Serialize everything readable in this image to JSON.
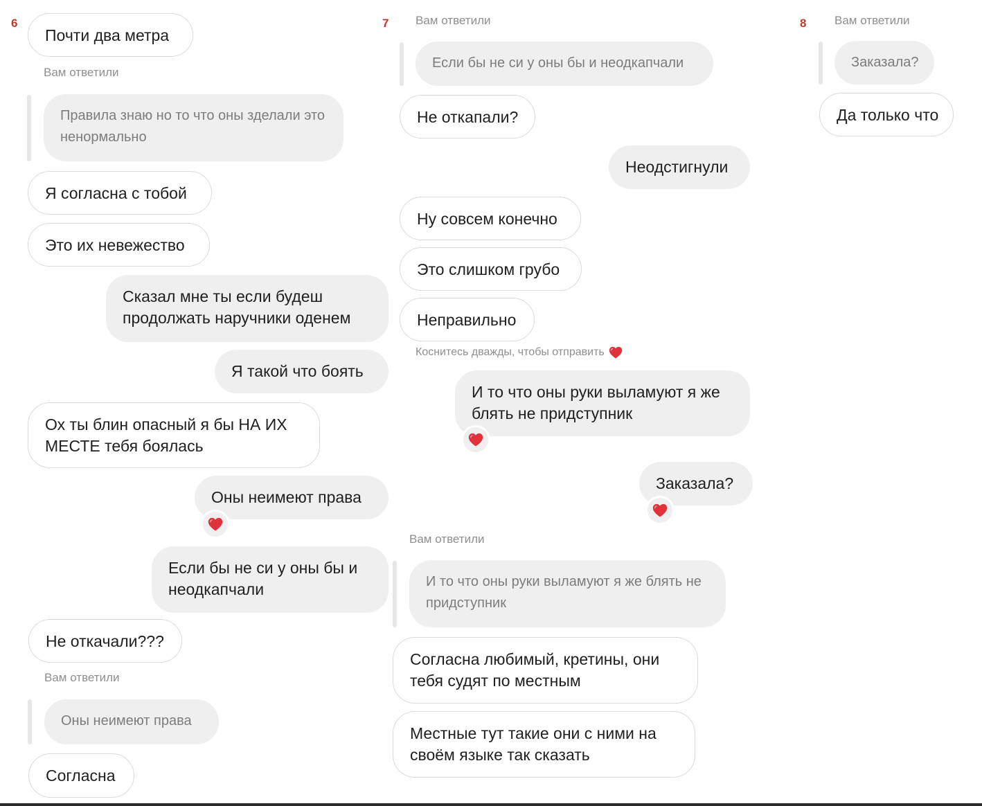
{
  "columns": [
    {
      "number": "6",
      "items": [
        {
          "text": "Почти два метра"
        },
        {
          "text": "Вам ответили"
        },
        {
          "text": "Правила знаю но то что оны зделали это ненормально"
        },
        {
          "text": "Я согласна с тобой"
        },
        {
          "text": "Это их невежество"
        },
        {
          "text": "Сказал мне ты если будеш продолжать наручники оденем"
        },
        {
          "text": "Я такой что боять"
        },
        {
          "text": "Ох ты блин опасный я бы НА ИХ МЕСТЕ тебя боялась"
        },
        {
          "text": "Оны неимеют права",
          "reaction": "heart"
        },
        {
          "text": "Если бы не си у оны бы и неодкапчали"
        },
        {
          "text": "Не откачали???"
        },
        {
          "text": "Вам ответили"
        },
        {
          "text": "Оны неимеют права"
        },
        {
          "text": "Согласна"
        }
      ]
    },
    {
      "number": "7",
      "items": [
        {
          "text": "Вам ответили"
        },
        {
          "text": "Если бы не си у оны бы и неодкапчали"
        },
        {
          "text": "Не откапали?"
        },
        {
          "text": "Неодстигнули"
        },
        {
          "text": "Ну совсем конечно"
        },
        {
          "text": "Это слишком грубо"
        },
        {
          "text": "Неправильно"
        },
        {
          "text": "Коснитесь дважды, чтобы отправить"
        },
        {
          "text": "И то что оны руки выламуют я же блять не придступник",
          "reaction": "heart"
        },
        {
          "text": "Заказала?",
          "reaction": "heart"
        },
        {
          "text": "Вам ответили"
        },
        {
          "text": "И то что оны руки выламуют я же блять не придступник"
        },
        {
          "text": "Согласна любимый, кретины, они тебя судят по местным"
        },
        {
          "text": "Местные тут такие они с ними на своём языке так сказать"
        }
      ]
    },
    {
      "number": "8",
      "items": [
        {
          "text": "Вам ответили"
        },
        {
          "text": "Заказала?"
        },
        {
          "text": "Да только что"
        }
      ]
    }
  ],
  "icons": {
    "reaction": "heart-icon",
    "heart_color": "#e0323c"
  },
  "colors": {
    "incoming_border": "#dbdbdb",
    "outgoing_bg": "#efefef",
    "meta_text": "#8e8e8e",
    "column_number": "#c0392b"
  }
}
